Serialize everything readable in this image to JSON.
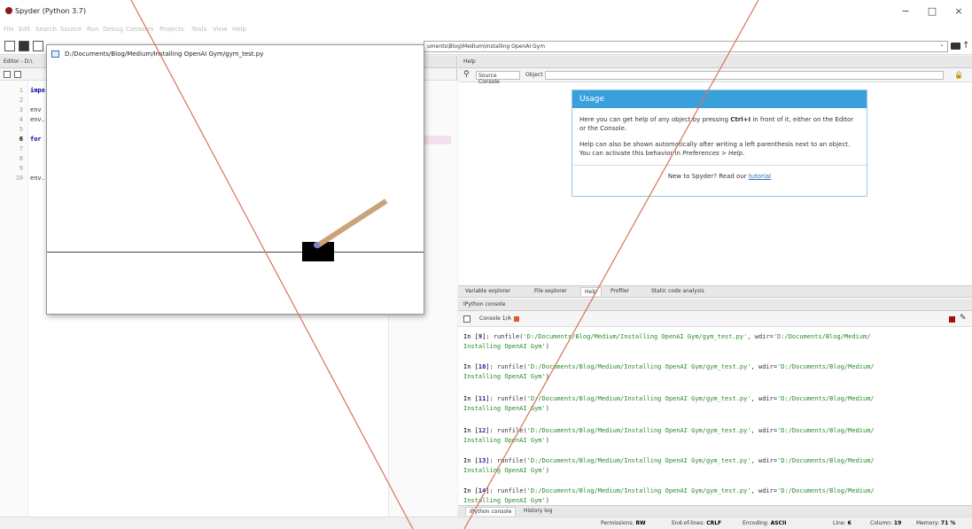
{
  "window": {
    "title": "Spyder (Python 3.7)",
    "minimize": "−",
    "maximize": "□",
    "close": "×"
  },
  "menu": [
    "File",
    "Edit",
    "Search",
    "Source",
    "Run",
    "Debug",
    "Consoles",
    "Projects",
    "Tools",
    "View",
    "Help"
  ],
  "toolbar": {
    "path": "uments\\Blog\\Medium\\Installing OpenAI Gym"
  },
  "editor": {
    "title": "Editor - D:\\",
    "lines": [
      {
        "no": "1",
        "text": "impo"
      },
      {
        "no": "2",
        "text": ""
      },
      {
        "no": "3",
        "text": "env"
      },
      {
        "no": "4",
        "text": "env."
      },
      {
        "no": "5",
        "text": ""
      },
      {
        "no": "6",
        "text": "for"
      },
      {
        "no": "7",
        "text": ""
      },
      {
        "no": "8",
        "text": ""
      },
      {
        "no": "9",
        "text": ""
      },
      {
        "no": "10",
        "text": "env."
      }
    ]
  },
  "gym_window": {
    "title": "D:/Documents/Blog/Medium/Installing OpenAI Gym/gym_test.py"
  },
  "help": {
    "pane_title": "Help",
    "source_label": "Source Console",
    "object_label": "Object",
    "usage_title": "Usage",
    "p1_before": "Here you can get help of any object by pressing ",
    "p1_key": "Ctrl+I",
    "p1_after": " in front of it, either on the Editor or the Console.",
    "p2": "Help can also be shown automatically after writing a left parenthesis next to an object. You can activate this behavior in ",
    "p2_pref": "Preferences > Help",
    "p2_end": ".",
    "footer_before": "New to Spyder? Read our ",
    "footer_link": "tutorial"
  },
  "pane_tabs": [
    "Variable explorer",
    "File explorer",
    "Help",
    "Profiler",
    "Static code analysis"
  ],
  "console": {
    "pane_title": "IPython console",
    "tab_label": "Console 1/A",
    "entries": [
      {
        "num": "9"
      },
      {
        "num": "10"
      },
      {
        "num": "11"
      },
      {
        "num": "12"
      },
      {
        "num": "13"
      },
      {
        "num": "14"
      }
    ],
    "cmd": "runfile(",
    "file_arg": "'D:/Documents/Blog/Medium/Installing OpenAI Gym/gym_test.py'",
    "wdir_label": ", wdir=",
    "wdir_part1": "'D:/Documents/Blog/Medium/",
    "wdir_part2": "Installing OpenAI Gym'",
    "close_paren": ")"
  },
  "bottom_tabs": [
    "IPython console",
    "History log"
  ],
  "status": {
    "permissions_label": "Permissions:",
    "permissions": "RW",
    "eol_label": "End-of-lines:",
    "eol": "CRLF",
    "encoding_label": "Encoding:",
    "encoding": "ASCII",
    "line_label": "Line:",
    "line": "6",
    "column_label": "Column:",
    "column": "19",
    "memory_label": "Memory:",
    "memory": "71 %"
  },
  "colors": {
    "usage_header": "#3aa0dc",
    "annotation_line": "#d9725b",
    "cart": "#000000",
    "pole": "#caa37a"
  }
}
